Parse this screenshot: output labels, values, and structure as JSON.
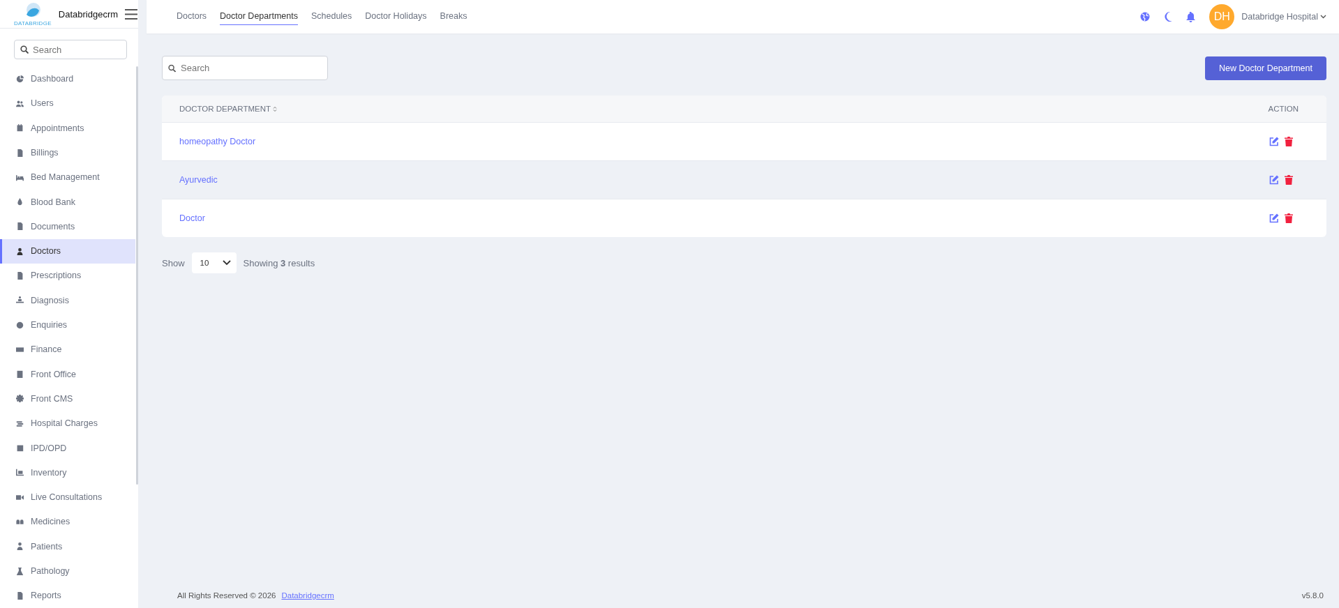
{
  "brand": {
    "name": "Databridgecrm",
    "logo_text": "DATABRIDGE"
  },
  "sidebar": {
    "search_placeholder": "Search",
    "items": [
      {
        "label": "Dashboard",
        "selected": false
      },
      {
        "label": "Users",
        "selected": false
      },
      {
        "label": "Appointments",
        "selected": false
      },
      {
        "label": "Billings",
        "selected": false
      },
      {
        "label": "Bed Management",
        "selected": false
      },
      {
        "label": "Blood Bank",
        "selected": false
      },
      {
        "label": "Documents",
        "selected": false
      },
      {
        "label": "Doctors",
        "selected": true
      },
      {
        "label": "Prescriptions",
        "selected": false
      },
      {
        "label": "Diagnosis",
        "selected": false
      },
      {
        "label": "Enquiries",
        "selected": false
      },
      {
        "label": "Finance",
        "selected": false
      },
      {
        "label": "Front Office",
        "selected": false
      },
      {
        "label": "Front CMS",
        "selected": false
      },
      {
        "label": "Hospital Charges",
        "selected": false
      },
      {
        "label": "IPD/OPD",
        "selected": false
      },
      {
        "label": "Inventory",
        "selected": false
      },
      {
        "label": "Live Consultations",
        "selected": false
      },
      {
        "label": "Medicines",
        "selected": false
      },
      {
        "label": "Patients",
        "selected": false
      },
      {
        "label": "Pathology",
        "selected": false
      },
      {
        "label": "Reports",
        "selected": false
      }
    ]
  },
  "tabs": [
    {
      "label": "Doctors",
      "selected": false
    },
    {
      "label": "Doctor Departments",
      "selected": true
    },
    {
      "label": "Schedules",
      "selected": false
    },
    {
      "label": "Doctor Holidays",
      "selected": false
    },
    {
      "label": "Breaks",
      "selected": false
    }
  ],
  "user": {
    "initials": "DH",
    "name": "Databridge Hospital"
  },
  "toolbar": {
    "search_placeholder": "Search",
    "new_button": "New Doctor Department"
  },
  "table": {
    "columns": [
      "DOCTOR DEPARTMENT",
      "ACTION"
    ],
    "rows": [
      {
        "name": "homeopathy Doctor"
      },
      {
        "name": "Ayurvedic"
      },
      {
        "name": "Doctor"
      }
    ]
  },
  "pagination": {
    "show_label": "Show",
    "per_page": "10",
    "summary": "Showing **3** results"
  },
  "footer": {
    "copyright": "All Rights Reserved © 2026",
    "link": "Databridgecrm",
    "version": "v5.8.0"
  }
}
